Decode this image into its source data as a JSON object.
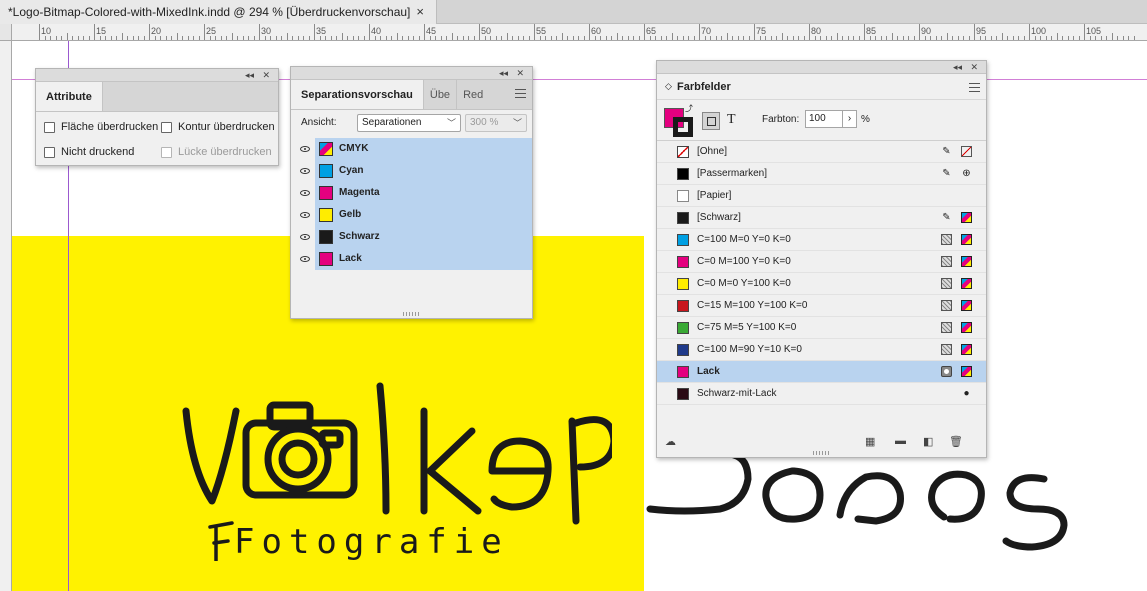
{
  "document_tab": {
    "title": "*Logo-Bitmap-Colored-with-MixedInk.indd @ 294 % [Überdruckenvorschau]",
    "close": "×"
  },
  "ruler": {
    "labels": [
      "10",
      "15",
      "20",
      "25",
      "30",
      "35",
      "40",
      "45",
      "50",
      "55",
      "60",
      "65",
      "70",
      "75",
      "80",
      "85",
      "90",
      "95",
      "100",
      "105"
    ]
  },
  "attribute_panel": {
    "tab": "Attribute",
    "options": {
      "flaeche": "Fläche überdrucken",
      "kontur": "Kontur überdrucken",
      "nicht_druckend": "Nicht druckend",
      "luecke": "Lücke überdrucken"
    }
  },
  "separations_panel": {
    "tabs": [
      "Separationsvorschau",
      "Übe",
      "Red"
    ],
    "view_label": "Ansicht:",
    "view_value": "Separationen",
    "zoom_value": "300 %",
    "plates": [
      {
        "name": "CMYK",
        "color": "cmyk"
      },
      {
        "name": "Cyan",
        "color": "#00a0e3"
      },
      {
        "name": "Magenta",
        "color": "#e4007f"
      },
      {
        "name": "Gelb",
        "color": "#ffed00"
      },
      {
        "name": "Schwarz",
        "color": "#1a1a1a"
      },
      {
        "name": "Lack",
        "color": "#e4007f"
      }
    ]
  },
  "swatches_panel": {
    "title": "Farbfelder",
    "tint_label": "Farbton:",
    "tint_value": "100",
    "tint_unit": "%",
    "text_icon": "T",
    "swatches": [
      {
        "name": "[Ohne]",
        "color": "none",
        "icon_a": "no-edit",
        "icon_b": "none-mark"
      },
      {
        "name": "[Passermarken]",
        "color": "#000000",
        "icon_a": "no-edit",
        "icon_b": "registration"
      },
      {
        "name": "[Papier]",
        "color": "#ffffff",
        "icon_a": "",
        "icon_b": ""
      },
      {
        "name": "[Schwarz]",
        "color": "#1a1a1a",
        "icon_a": "no-edit",
        "icon_b": "process-cmyk"
      },
      {
        "name": "C=100 M=0 Y=0 K=0",
        "color": "#00a0e3",
        "icon_a": "process",
        "icon_b": "cmyk"
      },
      {
        "name": "C=0 M=100 Y=0 K=0",
        "color": "#e4007f",
        "icon_a": "process",
        "icon_b": "cmyk"
      },
      {
        "name": "C=0 M=0 Y=100 K=0",
        "color": "#ffed00",
        "icon_a": "process",
        "icon_b": "cmyk"
      },
      {
        "name": "C=15 M=100 Y=100 K=0",
        "color": "#c8161d",
        "icon_a": "process",
        "icon_b": "cmyk"
      },
      {
        "name": "C=75 M=5 Y=100 K=0",
        "color": "#3aa935",
        "icon_a": "process",
        "icon_b": "cmyk"
      },
      {
        "name": "C=100 M=90 Y=10 K=0",
        "color": "#1f3a8a",
        "icon_a": "process",
        "icon_b": "cmyk"
      },
      {
        "name": "Lack",
        "color": "#e4007f",
        "icon_a": "spot",
        "icon_b": "cmyk",
        "selected": true
      },
      {
        "name": "Schwarz-mit-Lack",
        "color": "#2a0a14",
        "icon_a": "",
        "icon_b": "mixed-ink"
      }
    ]
  },
  "artwork": {
    "logo_name": "Volker",
    "logo_tagline": "Fotografie",
    "mirrored_text": "Jobs"
  },
  "colors": {
    "selection": "#b9d3ef",
    "guide": "#9b59d0",
    "page_yellow": "#fff200",
    "magenta": "#e4007f"
  }
}
